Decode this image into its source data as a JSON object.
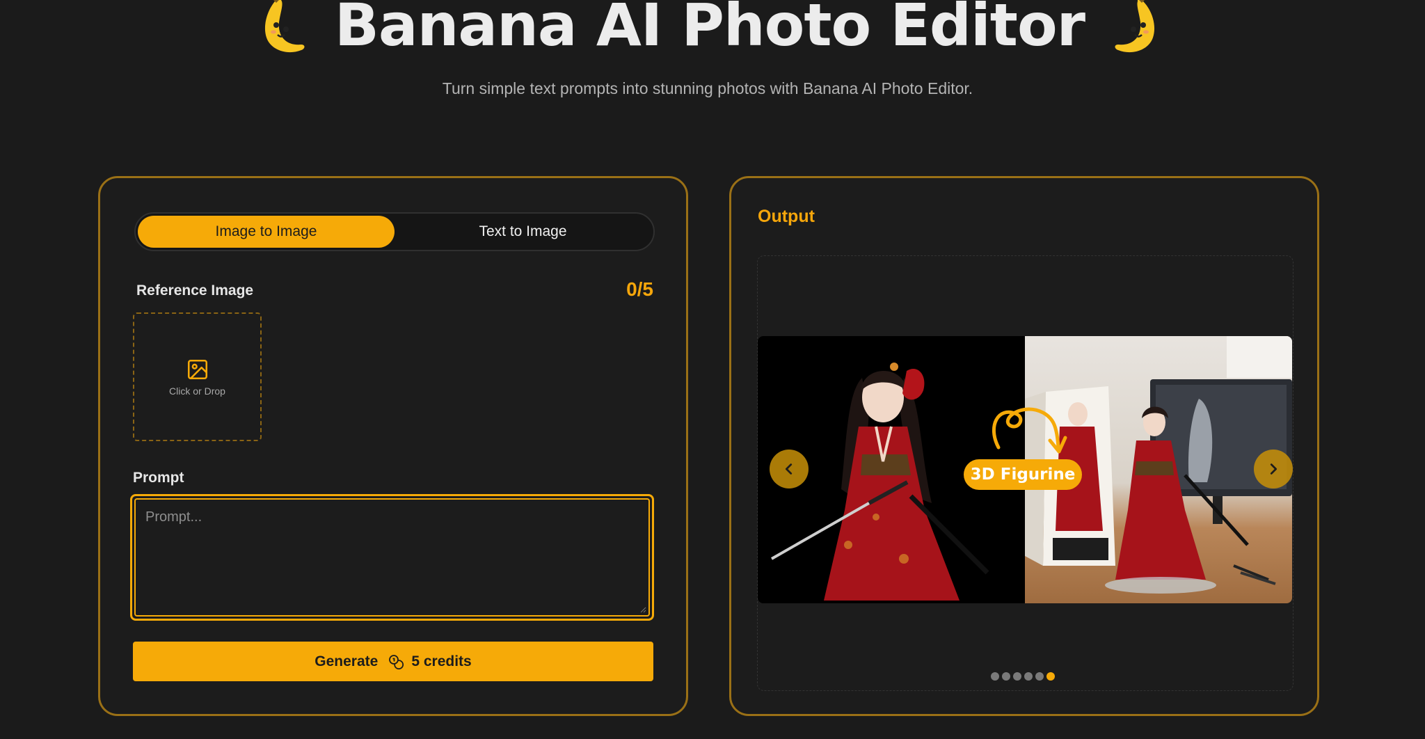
{
  "header": {
    "title": "Banana AI Photo Editor",
    "subtitle": "Turn simple text prompts into stunning photos with Banana AI Photo Editor.",
    "left_icon": "banana-mascot-icon",
    "right_icon": "banana-mascot-icon"
  },
  "input_panel": {
    "tabs": [
      {
        "label": "Image to Image",
        "active": true
      },
      {
        "label": "Text to Image",
        "active": false
      }
    ],
    "reference_label": "Reference Image",
    "reference_count": "0/5",
    "drop_text": "Click or Drop",
    "drop_icon": "image-icon",
    "prompt_label": "Prompt",
    "prompt_placeholder": "Prompt...",
    "prompt_value": "",
    "generate_label": "Generate",
    "credits_icon": "coins-icon",
    "credits_label": "5 credits"
  },
  "output_panel": {
    "title": "Output",
    "slide_badge": "3D Figurine",
    "prev_icon": "chevron-left-icon",
    "next_icon": "chevron-right-icon",
    "slide_count": 6,
    "active_slide_index": 5
  },
  "colors": {
    "accent": "#f6aa08",
    "background": "#1b1b1b",
    "card_border": "#9a7016"
  }
}
